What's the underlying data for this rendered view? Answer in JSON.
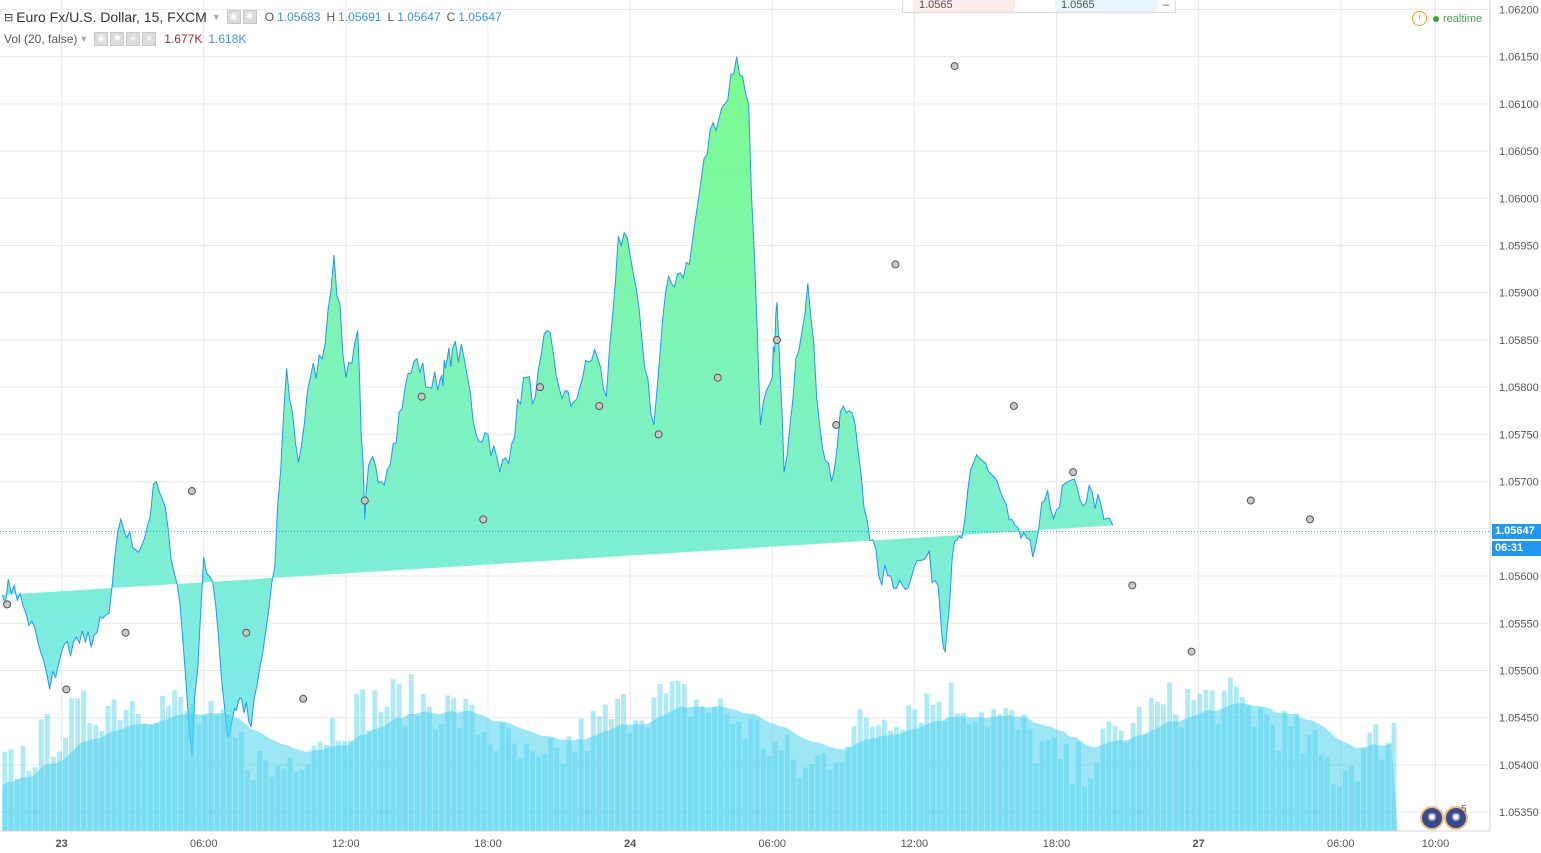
{
  "legend": {
    "symbol_title": "Euro Fx/U.S. Dollar, 15, FXCM",
    "o_label": "O",
    "o_value": "1.05683",
    "h_label": "H",
    "h_value": "1.05691",
    "l_label": "L",
    "l_value": "1.05647",
    "c_label": "C",
    "c_value": "1.05647",
    "vol_title": "Vol (20, false)",
    "vol_value1": "1.677K",
    "vol_value2": "1.618K"
  },
  "top_tag": {
    "bid": "1.0565",
    "ask": "1.0565"
  },
  "status": {
    "realtime": "realtime"
  },
  "price_tag": {
    "value": "1.05647",
    "countdown": "06:31"
  },
  "badges": {
    "events_count": "5"
  },
  "colors": {
    "line": "#2196f3",
    "area_top": "#7cfc8c",
    "area_bottom": "#7fe8f0",
    "volume": "#4dd2ee",
    "price_tag": "#2196f3",
    "grid": "#e9e9e9"
  },
  "chart_data": {
    "type": "area",
    "symbol": "Euro Fx/U.S. Dollar",
    "interval": "15",
    "ylim": [
      1.0533,
      1.0621
    ],
    "y_ticks": [
      "1.05350",
      "1.05400",
      "1.05450",
      "1.05500",
      "1.05550",
      "1.05600",
      "1.05650",
      "1.05700",
      "1.05750",
      "1.05800",
      "1.05850",
      "1.05900",
      "1.05950",
      "1.06000",
      "1.06050",
      "1.06100",
      "1.06150",
      "1.06200"
    ],
    "x_ticks": [
      {
        "label": "23",
        "hour": 16
      },
      {
        "label": "06:00",
        "hour": 22
      },
      {
        "label": "12:00",
        "hour": 28
      },
      {
        "label": "18:00",
        "hour": 34
      },
      {
        "label": "24",
        "hour": 40
      },
      {
        "label": "06:00",
        "hour": 46
      },
      {
        "label": "12:00",
        "hour": 52
      },
      {
        "label": "18:00",
        "hour": 58
      },
      {
        "label": "27",
        "hour": 64
      },
      {
        "label": "06:00",
        "hour": 70
      },
      {
        "label": "10:00",
        "hour": 74
      }
    ],
    "x_hours_range": [
      13.4,
      76.3
    ],
    "series": [
      {
        "hours": [
          13.5,
          14,
          14.5,
          15,
          15.5,
          16,
          16.5,
          17,
          17.5,
          18,
          18.5,
          19,
          19.5,
          20,
          20.5,
          21,
          21.5,
          22,
          22.5,
          23,
          23.3,
          23.6,
          24,
          24.5,
          25,
          25.5,
          26,
          26.5,
          27,
          27.5,
          28,
          28.5,
          28.8,
          29,
          29.5,
          30,
          30.5,
          31,
          31.5,
          32,
          32.2,
          32.5,
          33,
          33.5,
          34,
          34.5,
          35,
          35.5,
          36,
          36.5,
          37,
          37.5,
          38,
          38.5,
          39,
          39.5,
          40,
          40.5,
          41,
          41.5,
          42,
          42.5,
          43,
          43.5,
          44,
          44.5,
          45,
          45.5,
          46,
          46.2,
          46.5,
          47,
          47.5,
          48,
          48.5,
          49,
          49.5,
          50,
          50.5,
          51,
          51.5,
          52,
          52.5,
          53,
          53.3,
          53.6,
          54,
          54.5,
          55,
          55.5,
          56,
          56.5,
          57,
          57.5,
          58,
          58.5,
          59,
          59.5,
          60,
          60.5,
          61,
          61.5,
          62,
          62.5,
          63,
          63.5,
          64,
          64.5,
          65,
          65.5,
          66,
          66.5,
          67,
          67.5,
          68,
          68.5,
          69,
          69.5,
          70,
          70.5,
          71,
          71.5,
          72,
          72.4
        ],
        "values": [
          1.0558,
          1.0559,
          1.0556,
          1.0553,
          1.0548,
          1.0552,
          1.0553,
          1.0553,
          1.0554,
          1.0556,
          1.0566,
          1.0563,
          1.0564,
          1.057,
          1.0565,
          1.0557,
          1.0541,
          1.0562,
          1.0557,
          1.0543,
          1.0546,
          1.0547,
          1.0544,
          1.0552,
          1.0561,
          1.0582,
          1.0572,
          1.0581,
          1.0583,
          1.0594,
          1.0581,
          1.0586,
          1.0566,
          1.0572,
          1.057,
          1.0574,
          1.058,
          1.0583,
          1.058,
          1.0581,
          1.0582,
          1.0584,
          1.0583,
          1.0575,
          1.0575,
          1.0571,
          1.0574,
          1.0581,
          1.0579,
          1.0586,
          1.058,
          1.0578,
          1.0581,
          1.0584,
          1.0579,
          1.0596,
          1.0594,
          1.0585,
          1.0576,
          1.059,
          1.0592,
          1.0593,
          1.0602,
          1.0608,
          1.061,
          1.0615,
          1.061,
          1.0576,
          1.0581,
          1.0589,
          1.0571,
          1.0583,
          1.0591,
          1.0576,
          1.057,
          1.0578,
          1.0576,
          1.0566,
          1.056,
          1.056,
          1.0559,
          1.0561,
          1.0562,
          1.0559,
          1.0552,
          1.0562,
          1.0564,
          1.0572,
          1.0572,
          1.057,
          1.0566,
          1.0564,
          1.0562,
          1.0568,
          1.0567,
          1.057,
          1.0568,
          1.0569,
          1.0566,
          1.0565
        ],
        "markers": [
          [
            13.7,
            1.0557
          ],
          [
            16.2,
            1.0548
          ],
          [
            18.7,
            1.0554
          ],
          [
            21.5,
            1.0569
          ],
          [
            23.8,
            1.0554
          ],
          [
            26.2,
            1.0547
          ],
          [
            28.8,
            1.0568
          ],
          [
            31.2,
            1.0579
          ],
          [
            33.8,
            1.0566
          ],
          [
            36.2,
            1.058
          ],
          [
            38.7,
            1.0578
          ],
          [
            41.2,
            1.0575
          ],
          [
            43.7,
            1.0581
          ],
          [
            46.2,
            1.0585
          ],
          [
            48.7,
            1.0576
          ],
          [
            51.2,
            1.0593
          ],
          [
            53.7,
            1.0614
          ],
          [
            56.2,
            1.0578
          ],
          [
            58.7,
            1.0571
          ],
          [
            61.2,
            1.0559
          ],
          [
            63.7,
            1.0552
          ],
          [
            66.2,
            1.0568
          ],
          [
            68.7,
            1.0566
          ]
        ]
      }
    ],
    "volume": {
      "count": 230,
      "max": 1.0,
      "notes": "relative volume bars with moving average overlay"
    }
  }
}
